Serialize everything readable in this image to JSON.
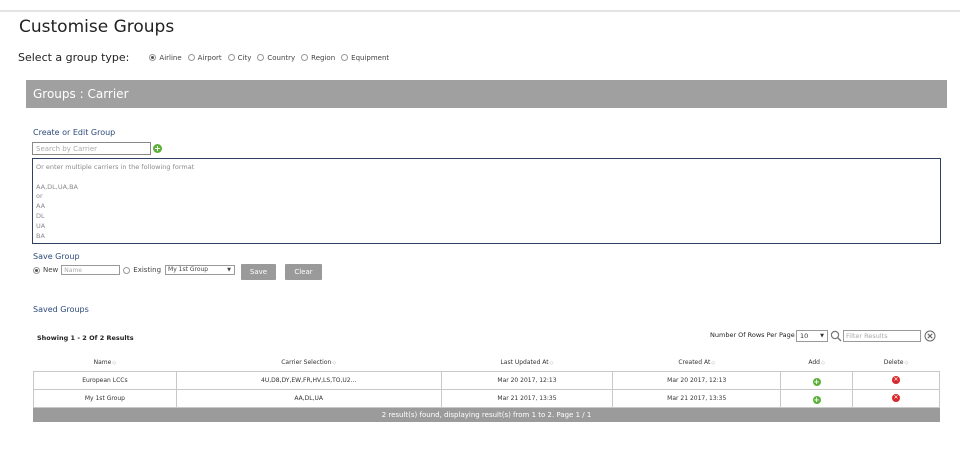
{
  "page": {
    "title": "Customise Groups"
  },
  "group_type": {
    "label": "Select a group type:",
    "options": [
      "Airline",
      "Airport",
      "City",
      "Country",
      "Region",
      "Equipment"
    ],
    "selected": "Airline"
  },
  "header": {
    "title": "Groups : Carrier"
  },
  "editor": {
    "section_label": "Create or Edit Group",
    "search_placeholder": "Search by Carrier",
    "carrier_text": "Or enter multiple carriers in the following format\n\nAA,DL,UA,BA\nor\nAA\nDL\nUA\nBA"
  },
  "save_group": {
    "section_label": "Save Group",
    "new_label": "New",
    "name_placeholder": "Name",
    "existing_label": "Existing",
    "existing_value": "My 1st Group",
    "save_label": "Save",
    "clear_label": "Clear"
  },
  "saved_groups": {
    "section_label": "Saved Groups",
    "showing": "Showing 1 - 2 Of 2 Results",
    "rows_per_page_label": "Number Of Rows Per Page",
    "rows_per_page_value": "10",
    "filter_placeholder": "Filter Results",
    "columns": [
      "Name",
      "Carrier Selection",
      "Last Updated At",
      "Created At",
      "Add",
      "Delete"
    ],
    "rows": [
      {
        "name": "European LCCs",
        "carriers": "4U,D8,DY,EW,FR,HV,LS,TO,U2...",
        "updated": "Mar 20 2017, 12:13",
        "created": "Mar 20 2017, 12:13"
      },
      {
        "name": "My 1st Group",
        "carriers": "AA,DL,UA",
        "updated": "Mar 21 2017, 13:35",
        "created": "Mar 21 2017, 13:35"
      }
    ],
    "footer": "2 result(s) found, displaying result(s) from 1 to 2. Page 1 / 1"
  },
  "colors": {
    "header_bar": "#a0a0a0",
    "accent_green": "#5cb13a",
    "delete_red": "#d9262a",
    "border_navy": "#2e4260"
  },
  "icons": {
    "add": "plus-circle-icon",
    "delete": "x-circle-icon",
    "search": "magnifier-icon",
    "clear": "circle-x-icon"
  }
}
